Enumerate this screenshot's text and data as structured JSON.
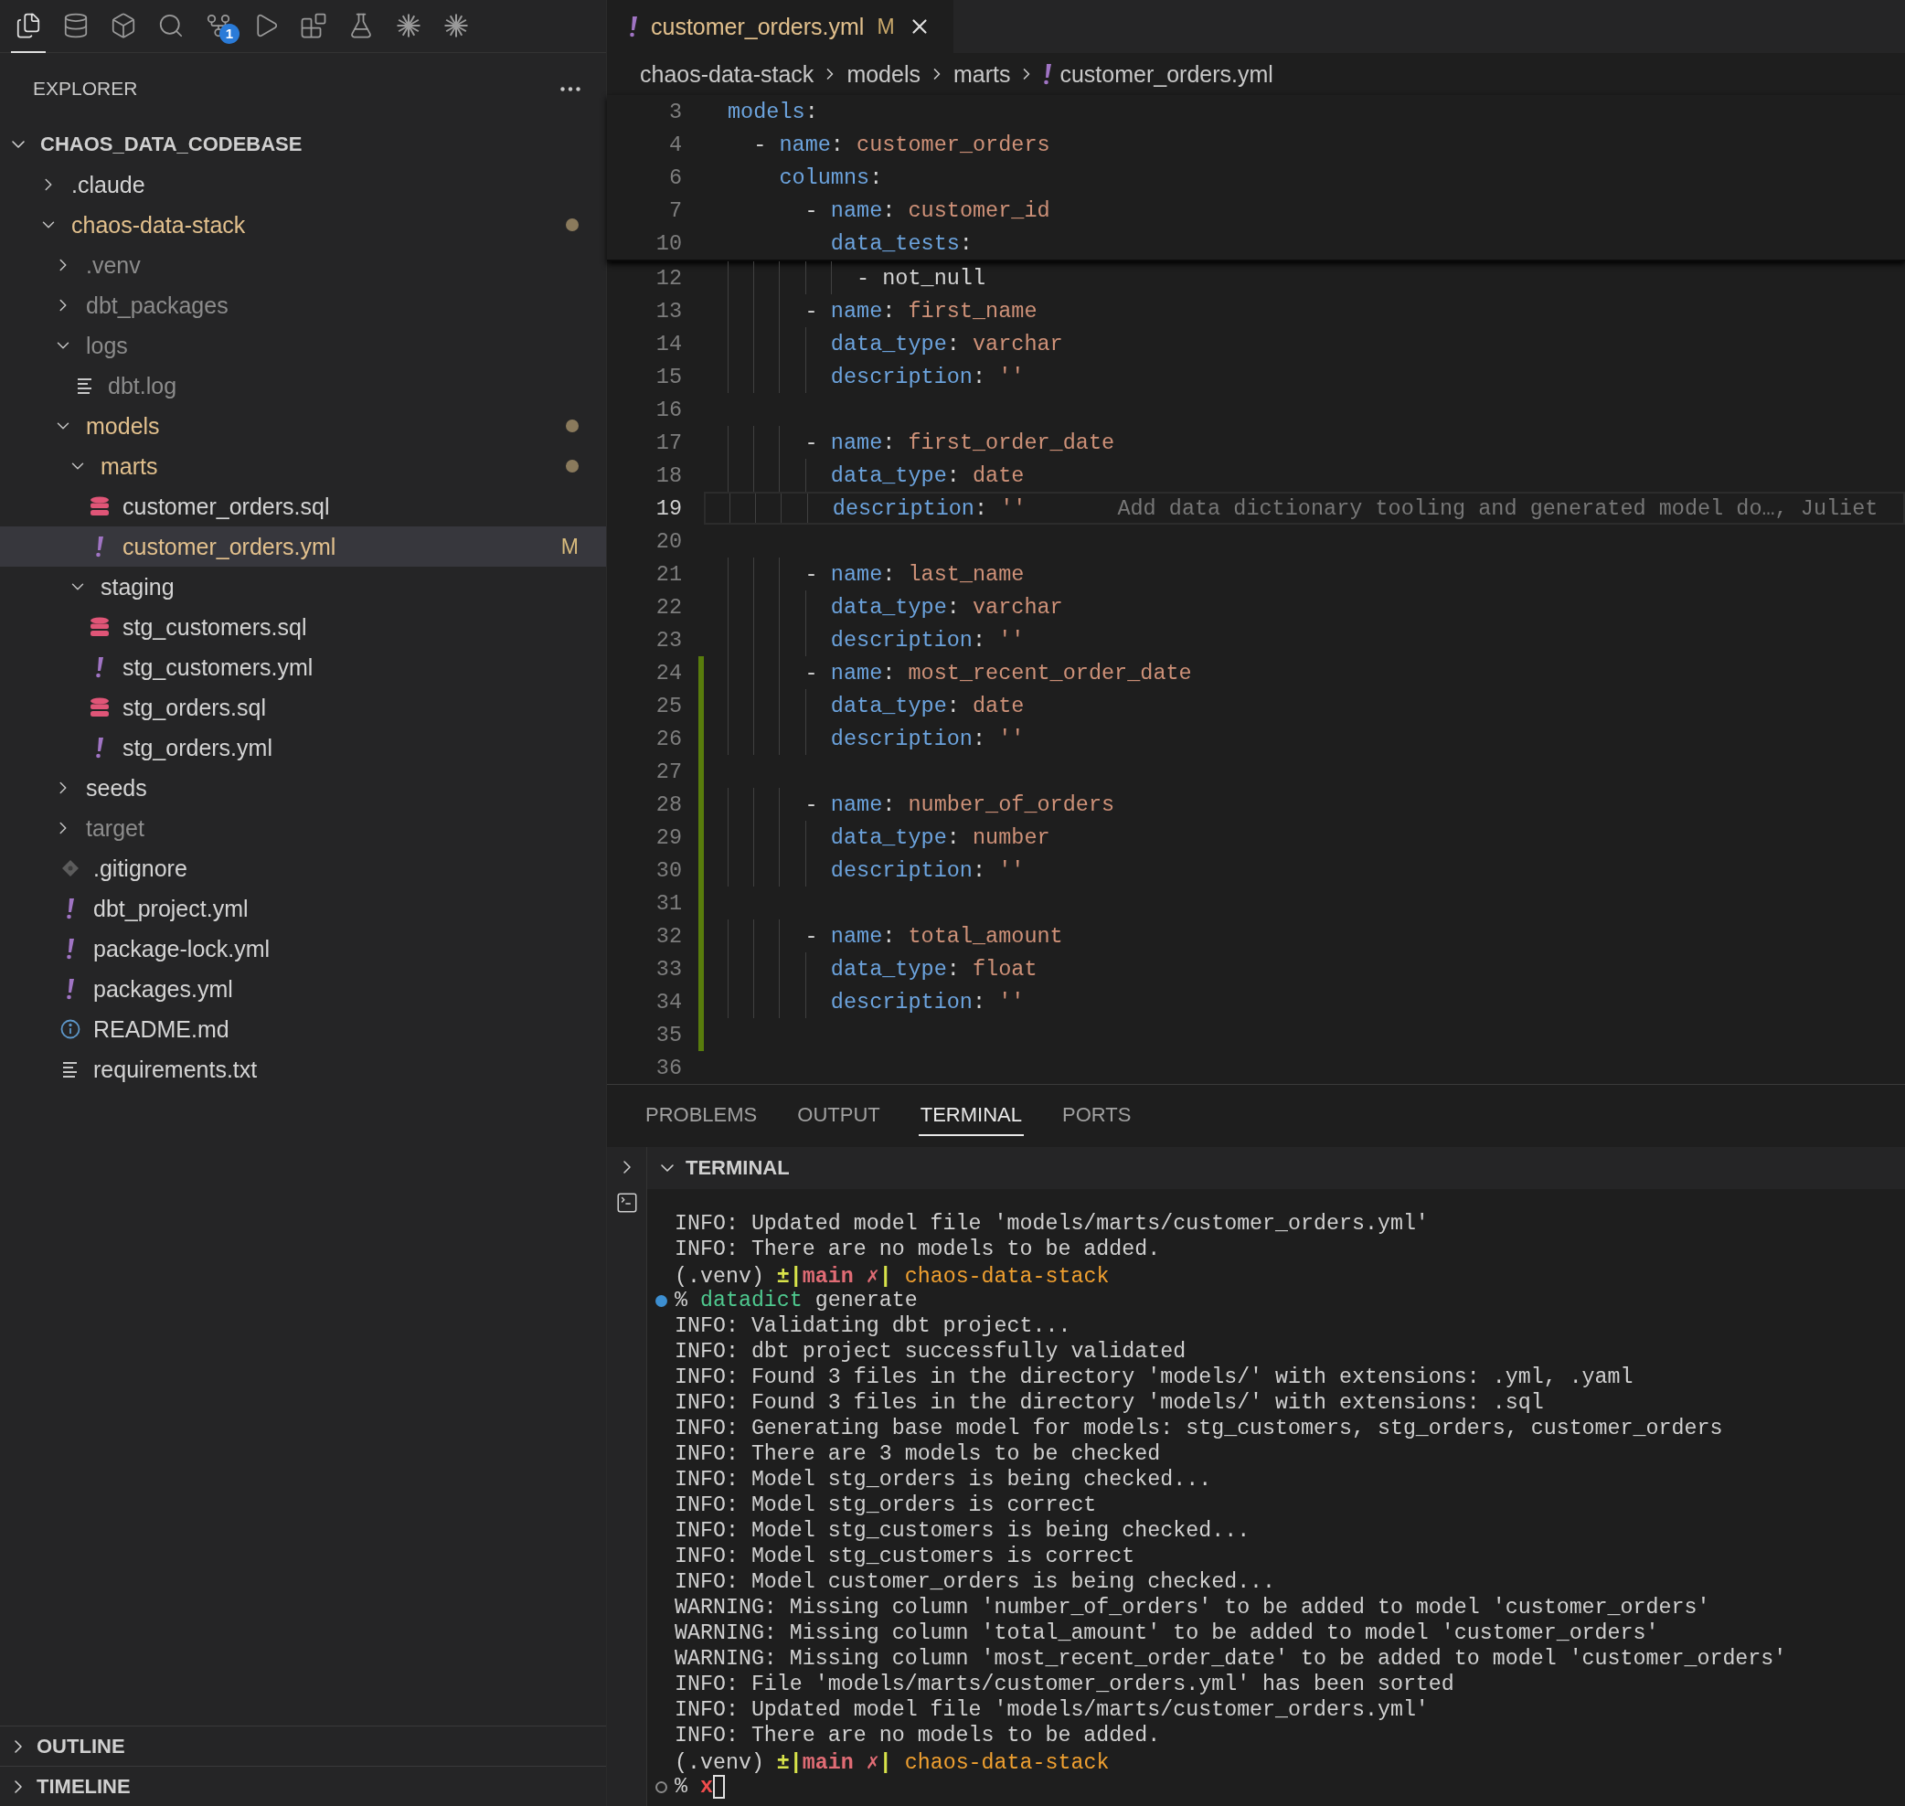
{
  "activity_bar": [
    {
      "kind": "explorer",
      "selected": true
    },
    {
      "kind": "database",
      "selected": false
    },
    {
      "kind": "cube",
      "selected": false
    },
    {
      "kind": "search",
      "selected": false
    },
    {
      "kind": "source-control",
      "selected": false,
      "badge": "1"
    },
    {
      "kind": "run-debug",
      "selected": false
    },
    {
      "kind": "extensions",
      "selected": false
    },
    {
      "kind": "testing",
      "selected": false
    },
    {
      "kind": "starburst",
      "selected": false
    },
    {
      "kind": "starburst",
      "selected": false
    }
  ],
  "explorer": {
    "title": "EXPLORER",
    "workspace": {
      "title": "CHAOS_DATA_CODEBASE",
      "expanded": true,
      "children": [
        {
          "kind": "folder",
          "label": ".claude",
          "expanded": false,
          "selected": false,
          "modified": false,
          "ignored": false
        },
        {
          "kind": "folder",
          "label": "chaos-data-stack",
          "expanded": true,
          "selected": false,
          "modified": true,
          "ignored": false,
          "children": [
            {
              "kind": "folder",
              "label": ".venv",
              "expanded": false,
              "selected": false,
              "modified": false,
              "ignored": true
            },
            {
              "kind": "folder",
              "label": "dbt_packages",
              "expanded": false,
              "selected": false,
              "modified": false,
              "ignored": true
            },
            {
              "kind": "folder",
              "label": "logs",
              "expanded": true,
              "selected": false,
              "modified": false,
              "ignored": true,
              "children": [
                {
                  "kind": "log",
                  "label": "dbt.log",
                  "selected": false,
                  "modified": false,
                  "ignored": true
                }
              ]
            },
            {
              "kind": "folder",
              "label": "models",
              "expanded": true,
              "selected": false,
              "modified": true,
              "ignored": false,
              "children": [
                {
                  "kind": "folder",
                  "label": "marts",
                  "expanded": true,
                  "selected": false,
                  "modified": true,
                  "ignored": false,
                  "children": [
                    {
                      "kind": "sql",
                      "label": "customer_orders.sql",
                      "selected": false,
                      "modified": false,
                      "ignored": false
                    },
                    {
                      "kind": "yaml",
                      "label": "customer_orders.yml",
                      "selected": true,
                      "modified": true,
                      "ignored": false,
                      "badge": "M"
                    }
                  ]
                },
                {
                  "kind": "folder",
                  "label": "staging",
                  "expanded": true,
                  "selected": false,
                  "modified": false,
                  "ignored": false,
                  "children": [
                    {
                      "kind": "sql",
                      "label": "stg_customers.sql",
                      "selected": false,
                      "modified": false,
                      "ignored": false
                    },
                    {
                      "kind": "yaml",
                      "label": "stg_customers.yml",
                      "selected": false,
                      "modified": false,
                      "ignored": false
                    },
                    {
                      "kind": "sql",
                      "label": "stg_orders.sql",
                      "selected": false,
                      "modified": false,
                      "ignored": false
                    },
                    {
                      "kind": "yaml",
                      "label": "stg_orders.yml",
                      "selected": false,
                      "modified": false,
                      "ignored": false
                    }
                  ]
                }
              ]
            },
            {
              "kind": "folder",
              "label": "seeds",
              "expanded": false,
              "selected": false,
              "modified": false,
              "ignored": false
            },
            {
              "kind": "folder",
              "label": "target",
              "expanded": false,
              "selected": false,
              "modified": false,
              "ignored": true
            },
            {
              "kind": "git",
              "label": ".gitignore",
              "selected": false,
              "modified": false,
              "ignored": false
            },
            {
              "kind": "yaml",
              "label": "dbt_project.yml",
              "selected": false,
              "modified": false,
              "ignored": false
            },
            {
              "kind": "yaml",
              "label": "package-lock.yml",
              "selected": false,
              "modified": false,
              "ignored": false
            },
            {
              "kind": "yaml",
              "label": "packages.yml",
              "selected": false,
              "modified": false,
              "ignored": false
            },
            {
              "kind": "info",
              "label": "README.md",
              "selected": false,
              "modified": false,
              "ignored": false
            },
            {
              "kind": "text",
              "label": "requirements.txt",
              "selected": false,
              "modified": false,
              "ignored": false
            }
          ]
        }
      ]
    }
  },
  "bottom_sections": [
    {
      "title": "OUTLINE",
      "expanded": false
    },
    {
      "title": "TIMELINE",
      "expanded": false
    }
  ],
  "tab": {
    "label": "customer_orders.yml",
    "status": "M",
    "selected": true
  },
  "breadcrumb": [
    "chaos-data-stack",
    "models",
    "marts",
    "customer_orders.yml"
  ],
  "sticky_lines": [
    {
      "number": "3",
      "tokens": [
        {
          "kind": "key",
          "text": "models"
        },
        {
          "kind": "plain",
          "text": ":"
        }
      ]
    },
    {
      "number": "4",
      "tokens": [
        {
          "kind": "plain",
          "text": "  - "
        },
        {
          "kind": "key",
          "text": "name"
        },
        {
          "kind": "plain",
          "text": ": "
        },
        {
          "kind": "value",
          "text": "customer_orders"
        }
      ]
    },
    {
      "number": "6",
      "tokens": [
        {
          "kind": "key",
          "text": "    columns"
        },
        {
          "kind": "plain",
          "text": ":"
        }
      ]
    },
    {
      "number": "7",
      "tokens": [
        {
          "kind": "plain",
          "text": "      - "
        },
        {
          "kind": "key",
          "text": "name"
        },
        {
          "kind": "plain",
          "text": ": "
        },
        {
          "kind": "value",
          "text": "customer_id"
        }
      ]
    },
    {
      "number": "10",
      "tokens": [
        {
          "kind": "key",
          "text": "        data_tests"
        },
        {
          "kind": "plain",
          "text": ":"
        }
      ]
    }
  ],
  "lines": [
    {
      "number": "12",
      "current": false,
      "added": false,
      "tokens": [
        {
          "kind": "plain",
          "text": "          - not_null"
        }
      ]
    },
    {
      "number": "13",
      "current": false,
      "added": false,
      "tokens": [
        {
          "kind": "plain",
          "text": "      - "
        },
        {
          "kind": "key",
          "text": "name"
        },
        {
          "kind": "plain",
          "text": ": "
        },
        {
          "kind": "value",
          "text": "first_name"
        }
      ]
    },
    {
      "number": "14",
      "current": false,
      "added": false,
      "tokens": [
        {
          "kind": "key",
          "text": "        data_type"
        },
        {
          "kind": "plain",
          "text": ": "
        },
        {
          "kind": "value",
          "text": "varchar"
        }
      ]
    },
    {
      "number": "15",
      "current": false,
      "added": false,
      "tokens": [
        {
          "kind": "key",
          "text": "        description"
        },
        {
          "kind": "plain",
          "text": ": "
        },
        {
          "kind": "value",
          "text": "''"
        }
      ]
    },
    {
      "number": "16",
      "current": false,
      "added": false
    },
    {
      "number": "17",
      "current": false,
      "added": false,
      "tokens": [
        {
          "kind": "plain",
          "text": "      - "
        },
        {
          "kind": "key",
          "text": "name"
        },
        {
          "kind": "plain",
          "text": ": "
        },
        {
          "kind": "value",
          "text": "first_order_date"
        }
      ]
    },
    {
      "number": "18",
      "current": false,
      "added": false,
      "tokens": [
        {
          "kind": "key",
          "text": "        data_type"
        },
        {
          "kind": "plain",
          "text": ": "
        },
        {
          "kind": "value",
          "text": "date"
        }
      ]
    },
    {
      "number": "19",
      "current": true,
      "added": false,
      "tokens": [
        {
          "kind": "key",
          "text": "        description"
        },
        {
          "kind": "plain",
          "text": ": "
        },
        {
          "kind": "value",
          "text": "''"
        }
      ],
      "blame": "Add data dictionary tooling and generated model do…, Juliet"
    },
    {
      "number": "20",
      "current": false,
      "added": false
    },
    {
      "number": "21",
      "current": false,
      "added": false,
      "tokens": [
        {
          "kind": "plain",
          "text": "      - "
        },
        {
          "kind": "key",
          "text": "name"
        },
        {
          "kind": "plain",
          "text": ": "
        },
        {
          "kind": "value",
          "text": "last_name"
        }
      ]
    },
    {
      "number": "22",
      "current": false,
      "added": false,
      "tokens": [
        {
          "kind": "key",
          "text": "        data_type"
        },
        {
          "kind": "plain",
          "text": ": "
        },
        {
          "kind": "value",
          "text": "varchar"
        }
      ]
    },
    {
      "number": "23",
      "current": false,
      "added": false,
      "tokens": [
        {
          "kind": "key",
          "text": "        description"
        },
        {
          "kind": "plain",
          "text": ": "
        },
        {
          "kind": "value",
          "text": "''"
        }
      ]
    },
    {
      "number": "24",
      "current": false,
      "added": true,
      "tokens": [
        {
          "kind": "plain",
          "text": "      - "
        },
        {
          "kind": "key",
          "text": "name"
        },
        {
          "kind": "plain",
          "text": ": "
        },
        {
          "kind": "value",
          "text": "most_recent_order_date"
        }
      ]
    },
    {
      "number": "25",
      "current": false,
      "added": true,
      "tokens": [
        {
          "kind": "key",
          "text": "        data_type"
        },
        {
          "kind": "plain",
          "text": ": "
        },
        {
          "kind": "value",
          "text": "date"
        }
      ]
    },
    {
      "number": "26",
      "current": false,
      "added": true,
      "tokens": [
        {
          "kind": "key",
          "text": "        description"
        },
        {
          "kind": "plain",
          "text": ": "
        },
        {
          "kind": "value",
          "text": "''"
        }
      ]
    },
    {
      "number": "27",
      "current": false,
      "added": true
    },
    {
      "number": "28",
      "current": false,
      "added": true,
      "tokens": [
        {
          "kind": "plain",
          "text": "      - "
        },
        {
          "kind": "key",
          "text": "name"
        },
        {
          "kind": "plain",
          "text": ": "
        },
        {
          "kind": "value",
          "text": "number_of_orders"
        }
      ]
    },
    {
      "number": "29",
      "current": false,
      "added": true,
      "tokens": [
        {
          "kind": "key",
          "text": "        data_type"
        },
        {
          "kind": "plain",
          "text": ": "
        },
        {
          "kind": "value",
          "text": "number"
        }
      ]
    },
    {
      "number": "30",
      "current": false,
      "added": true,
      "tokens": [
        {
          "kind": "key",
          "text": "        description"
        },
        {
          "kind": "plain",
          "text": ": "
        },
        {
          "kind": "value",
          "text": "''"
        }
      ]
    },
    {
      "number": "31",
      "current": false,
      "added": true
    },
    {
      "number": "32",
      "current": false,
      "added": true,
      "tokens": [
        {
          "kind": "plain",
          "text": "      - "
        },
        {
          "kind": "key",
          "text": "name"
        },
        {
          "kind": "plain",
          "text": ": "
        },
        {
          "kind": "value",
          "text": "total_amount"
        }
      ]
    },
    {
      "number": "33",
      "current": false,
      "added": true,
      "tokens": [
        {
          "kind": "key",
          "text": "        data_type"
        },
        {
          "kind": "plain",
          "text": ": "
        },
        {
          "kind": "value",
          "text": "float"
        }
      ]
    },
    {
      "number": "34",
      "current": false,
      "added": true,
      "tokens": [
        {
          "kind": "key",
          "text": "        description"
        },
        {
          "kind": "plain",
          "text": ": "
        },
        {
          "kind": "value",
          "text": "''"
        }
      ]
    },
    {
      "number": "35",
      "current": false,
      "added": true
    },
    {
      "number": "36",
      "current": false,
      "added": false
    }
  ],
  "panel_tabs": [
    {
      "label": "PROBLEMS",
      "selected": false
    },
    {
      "label": "OUTPUT",
      "selected": false
    },
    {
      "label": "TERMINAL",
      "selected": true
    },
    {
      "label": "PORTS",
      "selected": false
    }
  ],
  "terminal": {
    "title": "TERMINAL",
    "expanded": true,
    "lines": [
      {
        "tokens": [
          {
            "kind": "plain",
            "text": "INFO: Updated model file 'models/marts/customer_orders.yml'"
          }
        ]
      },
      {
        "tokens": [
          {
            "kind": "plain",
            "text": "INFO: There are no models to be added."
          }
        ]
      },
      {
        "tokens": [
          {
            "kind": "plain",
            "text": "(.venv) "
          },
          {
            "kind": "vcs",
            "text": "±|"
          },
          {
            "kind": "branch",
            "text": "main ✗"
          },
          {
            "kind": "vcs",
            "text": "| "
          },
          {
            "kind": "dir",
            "text": "chaos-data-stack"
          }
        ]
      },
      {
        "kind": "success",
        "tokens": [
          {
            "kind": "plain",
            "text": "% "
          },
          {
            "kind": "command",
            "text": "datadict"
          },
          {
            "kind": "plain",
            "text": " generate"
          }
        ]
      },
      {
        "tokens": [
          {
            "kind": "plain",
            "text": "INFO: Validating dbt project..."
          }
        ]
      },
      {
        "tokens": [
          {
            "kind": "plain",
            "text": "INFO: dbt project successfully validated"
          }
        ]
      },
      {
        "tokens": [
          {
            "kind": "plain",
            "text": "INFO: Found 3 files in the directory 'models/' with extensions: .yml, .yaml"
          }
        ]
      },
      {
        "tokens": [
          {
            "kind": "plain",
            "text": "INFO: Found 3 files in the directory 'models/' with extensions: .sql"
          }
        ]
      },
      {
        "tokens": [
          {
            "kind": "plain",
            "text": "INFO: Generating base model for models: stg_customers, stg_orders, customer_orders"
          }
        ]
      },
      {
        "tokens": [
          {
            "kind": "plain",
            "text": "INFO: There are 3 models to be checked"
          }
        ]
      },
      {
        "tokens": [
          {
            "kind": "plain",
            "text": "INFO: Model stg_orders is being checked..."
          }
        ]
      },
      {
        "tokens": [
          {
            "kind": "plain",
            "text": "INFO: Model stg_orders is correct"
          }
        ]
      },
      {
        "tokens": [
          {
            "kind": "plain",
            "text": "INFO: Model stg_customers is being checked..."
          }
        ]
      },
      {
        "tokens": [
          {
            "kind": "plain",
            "text": "INFO: Model stg_customers is correct"
          }
        ]
      },
      {
        "tokens": [
          {
            "kind": "plain",
            "text": "INFO: Model customer_orders is being checked..."
          }
        ]
      },
      {
        "tokens": [
          {
            "kind": "plain",
            "text": "WARNING: Missing column 'number_of_orders' to be added to model 'customer_orders'"
          }
        ]
      },
      {
        "tokens": [
          {
            "kind": "plain",
            "text": "WARNING: Missing column 'total_amount' to be added to model 'customer_orders'"
          }
        ]
      },
      {
        "tokens": [
          {
            "kind": "plain",
            "text": "WARNING: Missing column 'most_recent_order_date' to be added to model 'customer_orders'"
          }
        ]
      },
      {
        "tokens": [
          {
            "kind": "plain",
            "text": "INFO: File 'models/marts/customer_orders.yml' has been sorted"
          }
        ]
      },
      {
        "tokens": [
          {
            "kind": "plain",
            "text": "INFO: Updated model file 'models/marts/customer_orders.yml'"
          }
        ]
      },
      {
        "tokens": [
          {
            "kind": "plain",
            "text": "INFO: There are no models to be added."
          }
        ]
      },
      {
        "tokens": [
          {
            "kind": "plain",
            "text": "(.venv) "
          },
          {
            "kind": "vcs",
            "text": "±|"
          },
          {
            "kind": "branch",
            "text": "main ✗"
          },
          {
            "kind": "vcs",
            "text": "| "
          },
          {
            "kind": "dir",
            "text": "chaos-data-stack"
          }
        ]
      },
      {
        "kind": "pending",
        "cursor": true,
        "tokens": [
          {
            "kind": "plain",
            "text": "% "
          },
          {
            "kind": "error",
            "text": "x"
          }
        ]
      }
    ]
  }
}
